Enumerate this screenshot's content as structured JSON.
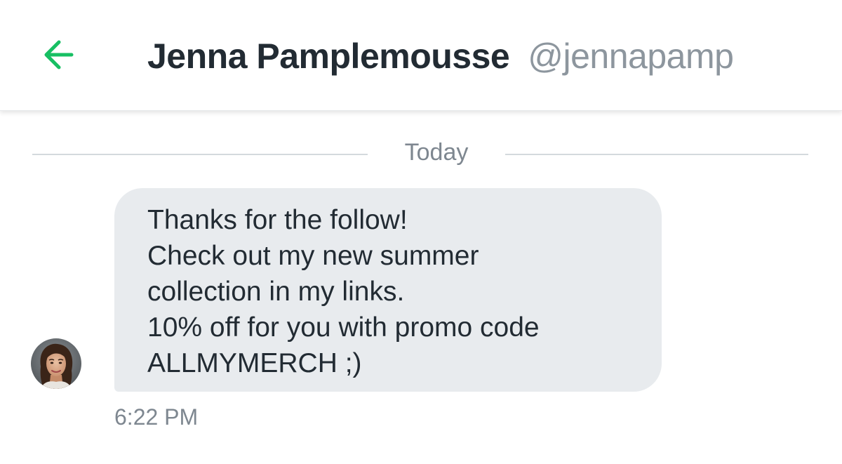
{
  "colors": {
    "accent": "#17bf63",
    "bubble_background": "#e8ebee",
    "primary_text": "#222b33",
    "secondary_text": "#8d969e"
  },
  "header": {
    "back_icon": "arrow-left-icon",
    "display_name": "Jenna Pamplemousse",
    "handle": "@jennapamp"
  },
  "conversation": {
    "date_divider": "Today",
    "messages": [
      {
        "sender_avatar": "avatar-photo",
        "lines": [
          "Thanks for the follow!",
          "Check out my new summer",
          "collection in my links.",
          "10% off for you with promo code",
          "ALLMYMERCH ;)"
        ],
        "time": "6:22 PM"
      }
    ]
  }
}
